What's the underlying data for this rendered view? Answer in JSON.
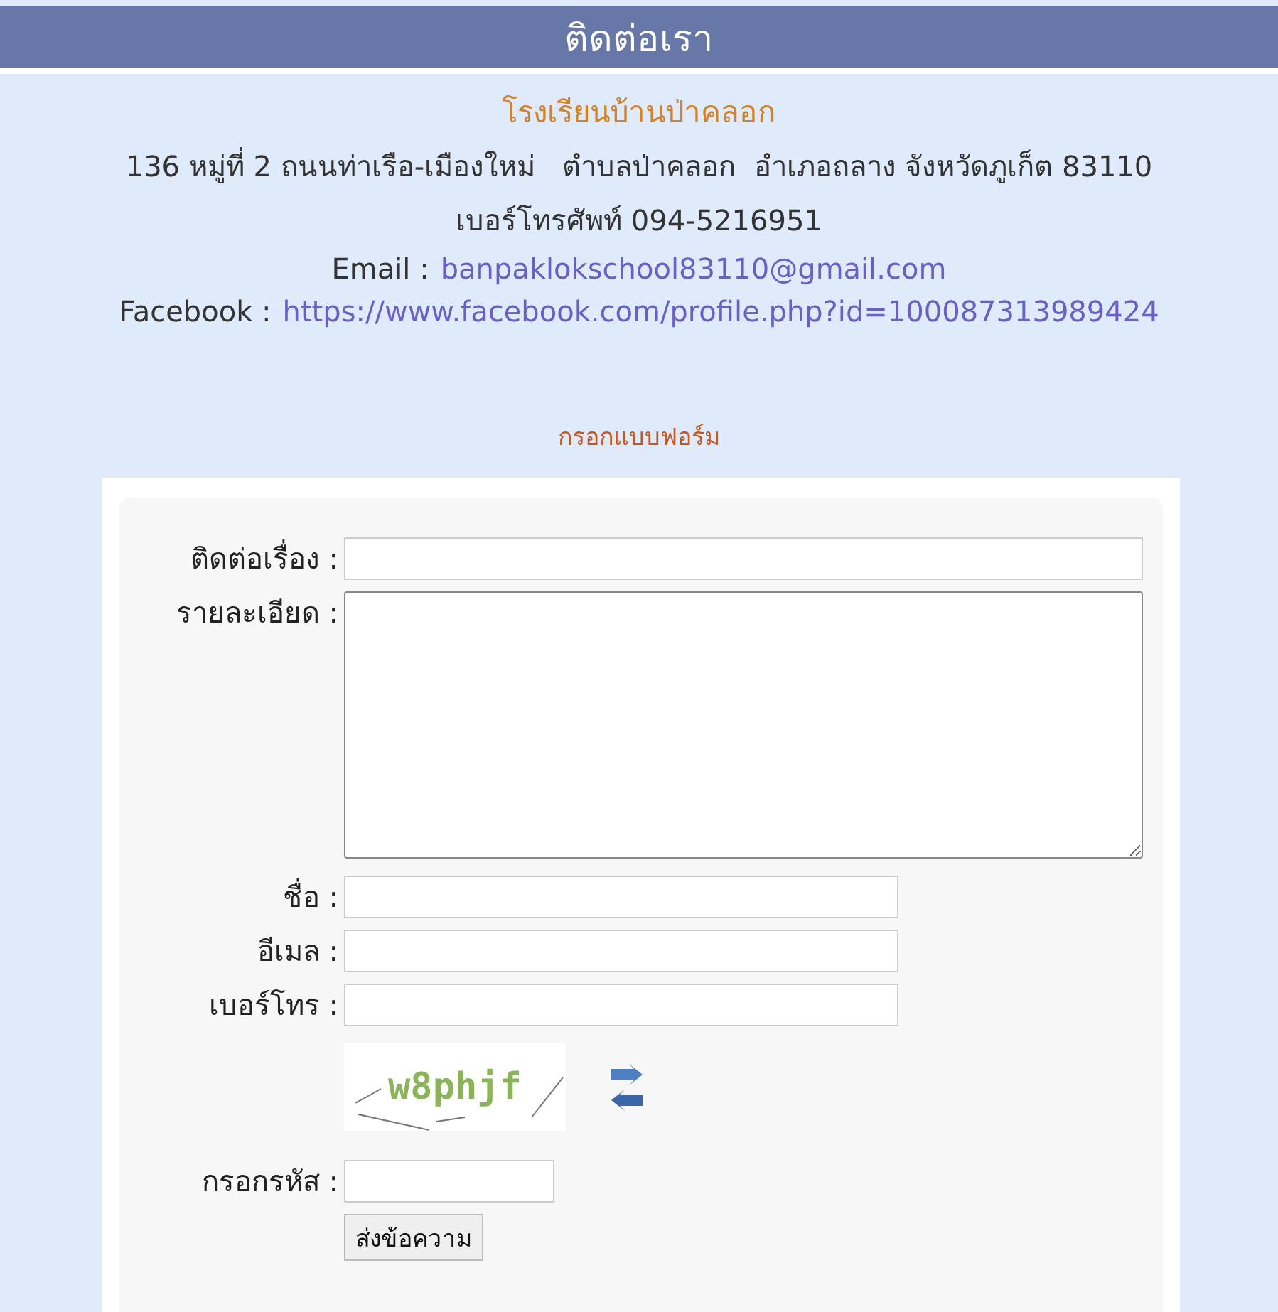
{
  "header": {
    "title": "ติดต่อเรา"
  },
  "contact": {
    "school": "โรงเรียนบ้านป่าคลอก",
    "address": "136 หมู่ที่ 2 ถนนท่าเรือ-เมืองใหม่   ตำบลป่าคลอก  อำเภอถลาง จังหวัดภูเก็ต 83110",
    "phone": "เบอร์โทรศัพท์ 094-5216951",
    "links": [
      {
        "label": "Email :",
        "link": "banpaklokschool83110@gmail.com"
      },
      {
        "label": "Facebook :",
        "link": "https://www.facebook.com/profile.php?id=100087313989424"
      }
    ]
  },
  "form": {
    "heading": "กรอกแบบฟอร์ม",
    "fields": [
      {
        "kind": "long",
        "label": "ติดต่อเรื่อง :"
      },
      {
        "kind": "textarea",
        "label": "รายละเอียด :"
      },
      {
        "kind": "short",
        "label": "ชื่อ :"
      },
      {
        "kind": "short",
        "label": "อีเมล :"
      },
      {
        "kind": "short",
        "label": "เบอร์โทร :"
      }
    ],
    "captcha": {
      "code": "w8phjf"
    },
    "code_field": {
      "label": "กรอกรหัส :"
    },
    "submit": "ส่งข้อความ"
  }
}
